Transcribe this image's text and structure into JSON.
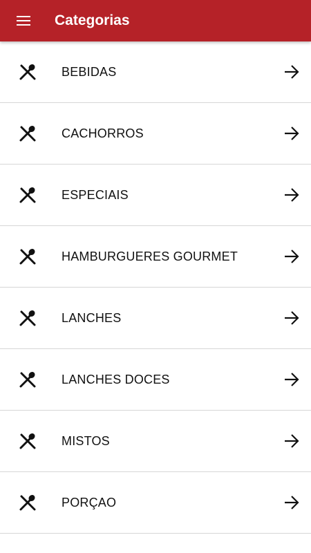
{
  "appbar": {
    "title": "Categorias",
    "menu_icon": "menu-icon",
    "background": "#b52228"
  },
  "categories": [
    {
      "label": "BEBIDAS",
      "icon": "utensils-icon",
      "action_icon": "arrow-right-icon"
    },
    {
      "label": "CACHORROS",
      "icon": "utensils-icon",
      "action_icon": "arrow-right-icon"
    },
    {
      "label": "ESPECIAIS",
      "icon": "utensils-icon",
      "action_icon": "arrow-right-icon"
    },
    {
      "label": "HAMBURGUERES GOURMET",
      "icon": "utensils-icon",
      "action_icon": "arrow-right-icon"
    },
    {
      "label": "LANCHES",
      "icon": "utensils-icon",
      "action_icon": "arrow-right-icon"
    },
    {
      "label": "LANCHES DOCES",
      "icon": "utensils-icon",
      "action_icon": "arrow-right-icon"
    },
    {
      "label": "MISTOS",
      "icon": "utensils-icon",
      "action_icon": "arrow-right-icon"
    },
    {
      "label": "PORÇAO",
      "icon": "utensils-icon",
      "action_icon": "arrow-right-icon"
    }
  ]
}
